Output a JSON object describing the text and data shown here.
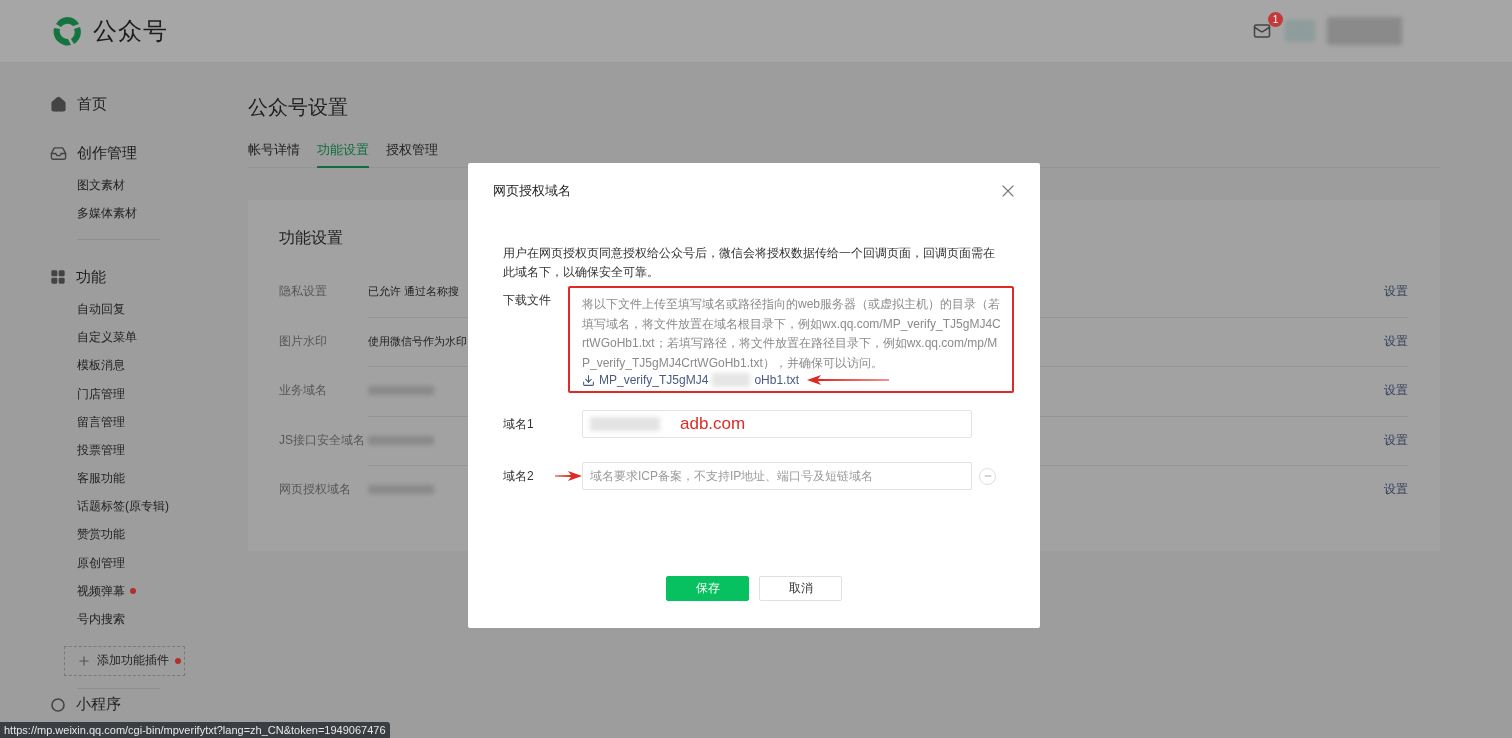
{
  "header": {
    "logo_text": "公众号",
    "mail_badge": "1"
  },
  "sidebar": {
    "sections": [
      {
        "label": "首页"
      },
      {
        "label": "创作管理",
        "items": [
          {
            "label": "图文素材",
            "dot": false
          },
          {
            "label": "多媒体素材",
            "dot": false
          }
        ]
      },
      {
        "label": "功能",
        "items": [
          {
            "label": "自动回复",
            "dot": false
          },
          {
            "label": "自定义菜单",
            "dot": false
          },
          {
            "label": "模板消息",
            "dot": false
          },
          {
            "label": "门店管理",
            "dot": false
          },
          {
            "label": "留言管理",
            "dot": false
          },
          {
            "label": "投票管理",
            "dot": false
          },
          {
            "label": "客服功能",
            "dot": false
          },
          {
            "label": "话题标签(原专辑)",
            "dot": false
          },
          {
            "label": "赞赏功能",
            "dot": false
          },
          {
            "label": "原创管理",
            "dot": false
          },
          {
            "label": "视频弹幕",
            "dot": true
          },
          {
            "label": "号内搜索",
            "dot": false
          }
        ]
      }
    ],
    "add_plugin": {
      "label": "添加功能插件",
      "dot": true
    },
    "last_section": {
      "label": "小程序"
    }
  },
  "page_title": "公众号设置",
  "tabs": [
    {
      "label": "帐号详情",
      "selected": false
    },
    {
      "label": "功能设置",
      "selected": true
    },
    {
      "label": "授权管理",
      "selected": false
    }
  ],
  "card": {
    "title": "功能设置",
    "rows": [
      {
        "kind": "text",
        "label": "隐私设置",
        "value": "已允许 通过名称搜",
        "action": "设置"
      },
      {
        "kind": "text",
        "label": "图片水印",
        "value": "使用微信号作为水印",
        "action": "设置"
      },
      {
        "kind": "redacted",
        "label": "业务域名",
        "action": "设置"
      },
      {
        "kind": "redacted",
        "label": "JS接口安全域名",
        "action": "设置"
      },
      {
        "kind": "redacted",
        "label": "网页授权域名",
        "action": "设置"
      }
    ]
  },
  "dialog": {
    "title": "网页授权域名",
    "description": "用户在网页授权页同意授权给公众号后，微信会将授权数据传给一个回调页面，回调页面需在此域名下，以确保安全可靠。",
    "download": {
      "label": "下载文件",
      "instructions": "将以下文件上传至填写域名或路径指向的web服务器（或虚拟主机）的目录（若填写域名，将文件放置在域名根目录下，例如wx.qq.com/MP_verify_TJ5gMJ4CrtWGoHb1.txt；若填写路径，将文件放置在路径目录下，例如wx.qq.com/mp/MP_verify_TJ5gMJ4CrtWGoHb1.txt），并确保可以访问。",
      "file_start": "MP_verify_TJ5gMJ4",
      "file_end": "oHb1.txt"
    },
    "domains": [
      {
        "label": "域名1",
        "value": "adb.com"
      },
      {
        "label": "域名2",
        "placeholder": "域名要求ICP备案，不支持IP地址、端口号及短链域名",
        "removable": true,
        "arrow": true
      }
    ],
    "buttons": [
      {
        "label": "保存",
        "kind": "primary"
      },
      {
        "label": "取消",
        "kind": "default"
      }
    ]
  },
  "status_bar": {
    "url": "https://mp.weixin.qq.com/cgi-bin/mpverifytxt?lang=zh_CN&token=1949067476"
  }
}
